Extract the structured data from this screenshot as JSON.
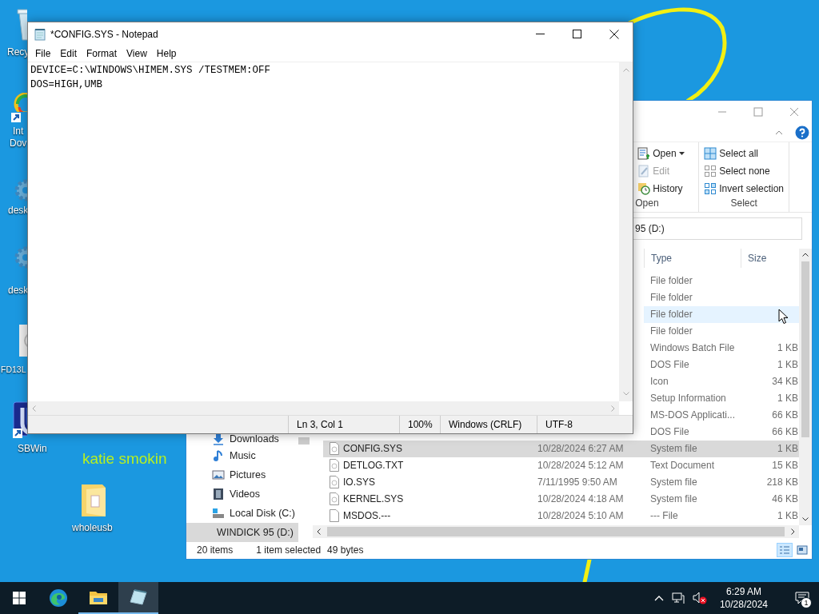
{
  "desktop": {
    "icons": [
      {
        "kind": "recycle-bin",
        "shortcut": false,
        "lines": [
          "Recy"
        ]
      },
      {
        "kind": "app",
        "shortcut": true,
        "lines": [
          "Int",
          "Dov"
        ]
      },
      {
        "kind": "gear",
        "shortcut": false,
        "lines": [
          "desk"
        ]
      },
      {
        "kind": "gear",
        "shortcut": false,
        "lines": [
          "desk"
        ]
      },
      {
        "kind": "disk",
        "shortcut": false,
        "lines": [
          "FD13L"
        ]
      },
      {
        "kind": "sb",
        "shortcut": true,
        "lines": [
          "SBWin"
        ]
      },
      {
        "kind": "folder",
        "shortcut": false,
        "lines": [
          "wholeusb"
        ]
      }
    ],
    "note": "katie smokin"
  },
  "explorer": {
    "ribbon": {
      "groups": [
        {
          "label": "Open",
          "items": [
            {
              "label": "Open",
              "dropdown": true,
              "disabled": false
            },
            {
              "label": "Edit",
              "dropdown": false,
              "disabled": true
            },
            {
              "label": "History",
              "dropdown": false,
              "disabled": false
            }
          ]
        },
        {
          "label": "Select",
          "items": [
            {
              "label": "Select all",
              "dropdown": false,
              "disabled": false
            },
            {
              "label": "Select none",
              "dropdown": false,
              "disabled": false
            },
            {
              "label": "Invert selection",
              "dropdown": false,
              "disabled": false
            }
          ]
        }
      ]
    },
    "address": "95 (D:)",
    "columns": [
      "Type",
      "Size"
    ],
    "rows": [
      {
        "type": "File folder",
        "hovered": false,
        "selected": false
      },
      {
        "type": "File folder",
        "hovered": false,
        "selected": false
      },
      {
        "type": "File folder",
        "hovered": true,
        "selected": false
      },
      {
        "type": "File folder",
        "hovered": false,
        "selected": false
      },
      {
        "type": "Windows Batch File",
        "size": "1 KB",
        "hovered": false,
        "selected": false
      },
      {
        "type": "DOS File",
        "size": "1 KB",
        "hovered": false,
        "selected": false
      },
      {
        "type": "Icon",
        "size": "34 KB",
        "hovered": false,
        "selected": false
      },
      {
        "type": "Setup Information",
        "size": "1 KB",
        "hovered": false,
        "selected": false
      },
      {
        "type": "MS-DOS Applicati...",
        "size": "66 KB",
        "hovered": false,
        "selected": false
      },
      {
        "type": "DOS File",
        "size": "66 KB",
        "hovered": false,
        "selected": false
      },
      {
        "name": "CONFIG.SYS",
        "date": "10/28/2024 6:27 AM",
        "type": "System file",
        "size": "1 KB",
        "hovered": false,
        "selected": true
      },
      {
        "name": "DETLOG.TXT",
        "date": "10/28/2024 5:12 AM",
        "type": "Text Document",
        "size": "15 KB",
        "hovered": false,
        "selected": false
      },
      {
        "name": "IO.SYS",
        "date": "7/11/1995 9:50 AM",
        "type": "System file",
        "size": "218 KB",
        "hovered": false,
        "selected": false
      },
      {
        "name": "KERNEL.SYS",
        "date": "10/28/2024 4:18 AM",
        "type": "System file",
        "size": "46 KB",
        "hovered": false,
        "selected": false
      },
      {
        "name": "MSDOS.---",
        "date": "10/28/2024 5:10 AM",
        "type": "--- File",
        "size": "1 KB",
        "hovered": false,
        "selected": false
      }
    ],
    "nav": [
      {
        "label": "Downloads",
        "selected": false,
        "expandable": false
      },
      {
        "label": "Music",
        "selected": false,
        "expandable": false
      },
      {
        "label": "Pictures",
        "selected": false,
        "expandable": false
      },
      {
        "label": "Videos",
        "selected": false,
        "expandable": false
      },
      {
        "label": "Local Disk (C:)",
        "selected": false,
        "expandable": false
      },
      {
        "label": "WINDICK 95 (D:)",
        "selected": true,
        "expandable": true
      }
    ],
    "status": {
      "count": "20 items",
      "selection": "1 item selected",
      "size": "49 bytes"
    },
    "views": [
      {
        "selected": true
      },
      {
        "selected": false
      }
    ]
  },
  "notepad": {
    "title": "*CONFIG.SYS - Notepad",
    "menu": [
      "File",
      "Edit",
      "Format",
      "View",
      "Help"
    ],
    "lines": [
      "DEVICE=C:\\WINDOWS\\HIMEM.SYS /TESTMEM:OFF",
      "DOS=HIGH,UMB"
    ],
    "status": [
      "Ln 3, Col 1",
      "100%",
      "Windows (CRLF)",
      "UTF-8"
    ]
  },
  "taskbar": {
    "apps": [
      {
        "kind": "edge",
        "running": false,
        "selected": false
      },
      {
        "kind": "explorer",
        "running": true,
        "selected": false
      },
      {
        "kind": "notepad",
        "running": true,
        "selected": true
      }
    ],
    "tray": {
      "muted": true,
      "time": "6:29 AM",
      "date": "10/28/2024",
      "notifications": "1"
    }
  }
}
